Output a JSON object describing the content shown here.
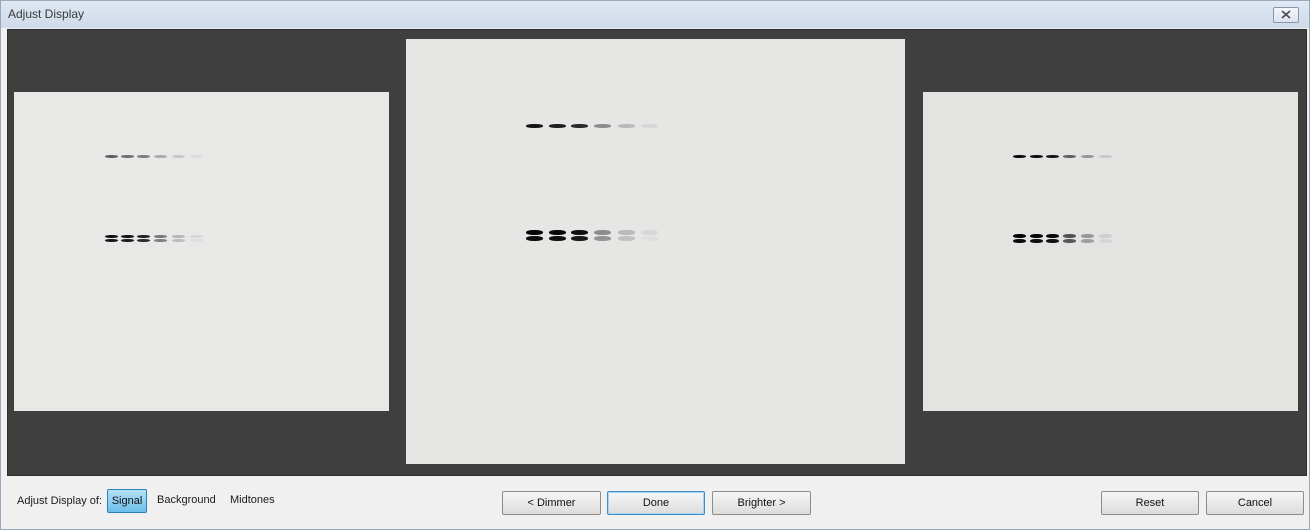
{
  "window": {
    "title": "Adjust Display"
  },
  "controls": {
    "adjust_label": "Adjust Display of:",
    "tabs": [
      "Signal",
      "Background",
      "Midtones"
    ],
    "selected_tab": "Signal",
    "dimmer": "< Dimmer",
    "done": "Done",
    "brighter": "Brighter >",
    "reset": "Reset",
    "cancel": "Cancel"
  },
  "previews": [
    {
      "name": "dimmer-preview",
      "brightness": "dimmer"
    },
    {
      "name": "current-preview",
      "brightness": "current"
    },
    {
      "name": "brighter-preview",
      "brightness": "brighter"
    }
  ],
  "colors": {
    "preview_background": "#3f3f3f",
    "gel_background": "#e6e6e4",
    "selected_tab": "#6cc0ea"
  }
}
